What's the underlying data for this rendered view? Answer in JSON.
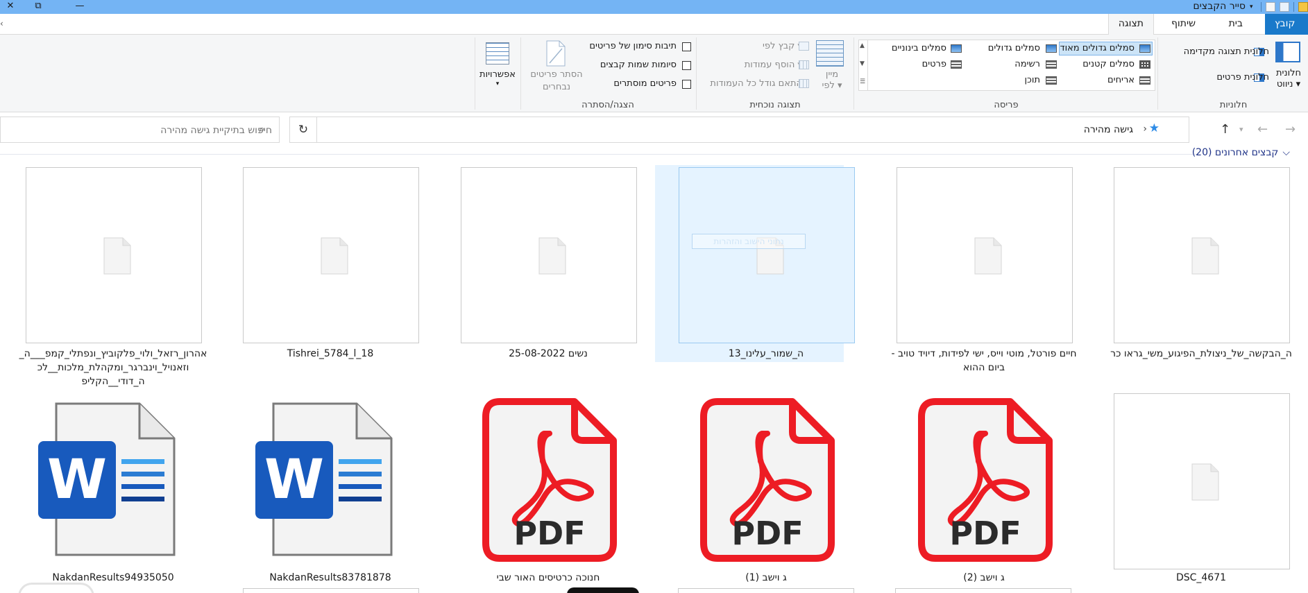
{
  "window": {
    "title": "סייר הקבצים",
    "controls": {
      "restore": "⧉",
      "minimize": "—",
      "close": "✕"
    }
  },
  "tabs": [
    {
      "label": "קובץ"
    },
    {
      "label": "בית"
    },
    {
      "label": "שיתוף"
    },
    {
      "label": "תצוגה"
    }
  ],
  "ribbon": {
    "panes": {
      "label": "חלוניות",
      "nav_pane": "חלונית ניווט",
      "preview_pane": "חלונית תצוגה מקדימה",
      "details_pane": "חלונית פרטים"
    },
    "layout": {
      "label": "פריסה",
      "extra_large": "סמלים גדולים מאוד",
      "large": "סמלים גדולים",
      "medium": "סמלים בינוניים",
      "small": "סמלים קטנים",
      "list": "רשימה",
      "details": "פרטים",
      "tiles": "אריחים",
      "content": "תוכן"
    },
    "current_view": {
      "label": "תצוגה נוכחית",
      "sort_by": "מיין לפי",
      "group_by": "קבץ לפי",
      "add_columns": "הוסף עמודות",
      "size_columns": "התאם גודל כל העמודות"
    },
    "show_hide": {
      "label": "הצגה/הסתרה",
      "item_checkboxes": "תיבות סימון של פריטים",
      "file_extensions": "סיומות שמות קבצים",
      "hidden_items": "פריטים מוסתרים",
      "hide_selected_line1": "הסתר פריטים",
      "hide_selected_line2": "נבחרים"
    },
    "options": {
      "label": "אפשרויות"
    }
  },
  "address": {
    "path": "גישה מהירה",
    "search_placeholder": "חיפוש בתיקיית גישה מהירה"
  },
  "section": {
    "title": "קבצים אחרונים (20)"
  },
  "files_row1": [
    {
      "name": "ה_הבקשה_של_ניצולת_הפיגוע_משי_גראו כר"
    },
    {
      "name": "חיים פורטל, מוטי וייס, ישי לפידות, דיויד טויב - ביום ההוא"
    },
    {
      "name": "ה_שמור_עלינו_13",
      "rename_text": "נתוני הישוב והזהרות"
    },
    {
      "name": "נשים 25-08-2022"
    },
    {
      "name": "18_Tishrei_5784_l"
    },
    {
      "name": "אהרון_רזאל_ולוי_פלקוביץ_ונפתלי_קמפ___ה_וזאנויל_וינברגר_ומקהלת_מלכות__לכ ה_דודי__הקליפ"
    }
  ],
  "files_row2": [
    {
      "name": "DSC_4671",
      "type": "generic"
    },
    {
      "name": "ג וישב (2)",
      "type": "pdf",
      "badge": "PDF"
    },
    {
      "name": "ג וישב (1)",
      "type": "pdf",
      "badge": "PDF"
    },
    {
      "name": "חנוכה כרטיסים האור שבי",
      "type": "pdf",
      "badge": "PDF"
    },
    {
      "name": "NakdanResults83781878",
      "type": "word",
      "badge": "W"
    },
    {
      "name": "NakdanResults94935050",
      "type": "word",
      "badge": "W"
    }
  ],
  "colors": {
    "titlebar": "#74b4f4",
    "file_tab": "#1979ca",
    "selection": "#e5f3ff",
    "pdf_red": "#ed1c24",
    "word_blue": "#185abd",
    "section_header": "#1e3287"
  }
}
